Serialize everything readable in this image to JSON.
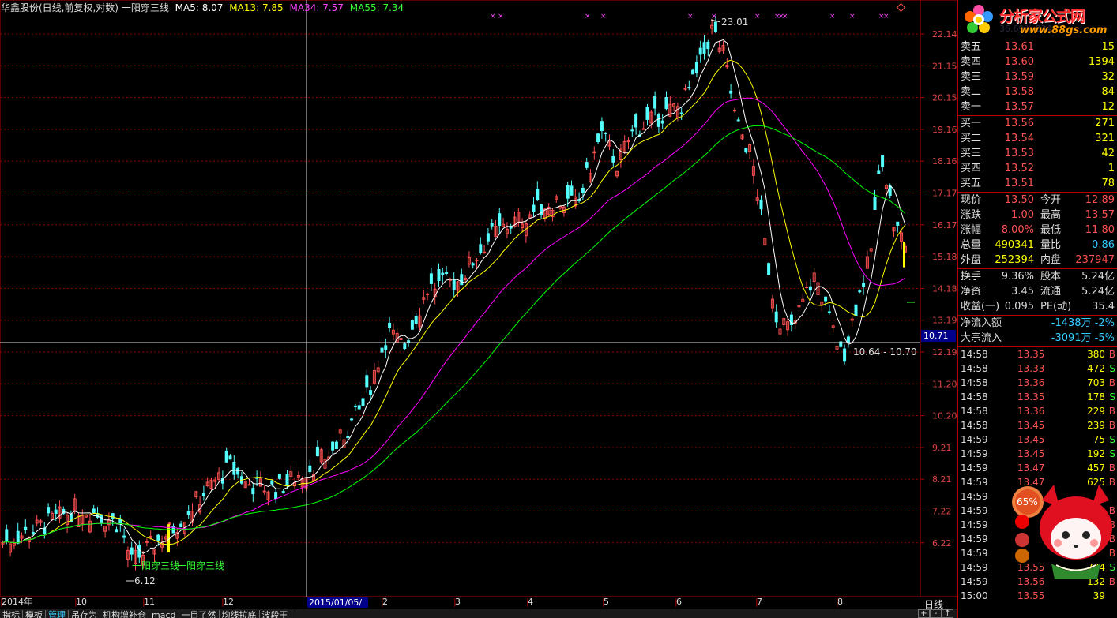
{
  "title": {
    "stock": "华鑫股份(日线,前复权,对数)",
    "indicator": "一阳穿三线",
    "ma5": "MA5: 8.07",
    "ma13": "MA13: 7.85",
    "ma34": "MA34: 7.57",
    "ma55": "MA55: 7.34"
  },
  "colors": {
    "bg": "#000000",
    "up": "#ff5050",
    "down": "#54ffff",
    "grid": "#b00000",
    "ma5": "#ffffff",
    "ma13": "#ffff00",
    "ma34": "#ff00ff",
    "ma55": "#00ff00",
    "special": "#ffff00"
  },
  "price_axis": {
    "labels": [
      "22.14",
      "21.15",
      "20.15",
      "19.16",
      "18.16",
      "17.17",
      "16.17",
      "15.18",
      "14.18",
      "13.19",
      "12.19",
      "11.20",
      "10.20",
      "9.21",
      "8.21",
      "7.22",
      "6.22"
    ]
  },
  "date_axis": {
    "labels": [
      "2014年",
      "10",
      "11",
      "12",
      "2",
      "3",
      "4",
      "5",
      "6",
      "7",
      "8"
    ],
    "cursor_date": "2015/01/05/一",
    "period": "日线"
  },
  "chart_data": {
    "type": "candlestick",
    "x_start": "2014-09",
    "x_end": "2015-08",
    "log_scale": true,
    "ylim": [
      5.9,
      23.4
    ],
    "annotations": {
      "high": "23.01",
      "low": "6.12",
      "range": "10.64 - 10.70",
      "cursor_price": "10.71",
      "signal_label": "一阳穿三线",
      "signal_label2": "一阳穿三线"
    },
    "ma_values": {
      "MA5": 8.07,
      "MA13": 7.85,
      "MA34": 7.57,
      "MA55": 7.34
    }
  },
  "quote": {
    "sell": [
      {
        "label": "卖五",
        "price": "13.61",
        "vol": "15"
      },
      {
        "label": "卖四",
        "price": "13.60",
        "vol": "1394"
      },
      {
        "label": "卖三",
        "price": "13.59",
        "vol": "32"
      },
      {
        "label": "卖二",
        "price": "13.58",
        "vol": "84"
      },
      {
        "label": "卖一",
        "price": "13.57",
        "vol": "12"
      }
    ],
    "buy": [
      {
        "label": "买一",
        "price": "13.56",
        "vol": "271"
      },
      {
        "label": "买二",
        "price": "13.54",
        "vol": "321"
      },
      {
        "label": "买三",
        "price": "13.53",
        "vol": "42"
      },
      {
        "label": "买四",
        "price": "13.52",
        "vol": "1"
      },
      {
        "label": "买五",
        "price": "13.51",
        "vol": "78"
      }
    ],
    "stats": [
      {
        "l1": "现价",
        "v1": "13.50",
        "l2": "今开",
        "v2": "12.89"
      },
      {
        "l1": "涨跌",
        "v1": "1.00",
        "l2": "最高",
        "v2": "13.57"
      },
      {
        "l1": "涨幅",
        "v1": "8.00%",
        "l2": "最低",
        "v2": "11.80"
      },
      {
        "l1": "总量",
        "v1": "490341",
        "l2": "量比",
        "v2": "0.86"
      },
      {
        "l1": "外盘",
        "v1": "252394",
        "l2": "内盘",
        "v2": "237947"
      }
    ],
    "stats2": [
      {
        "l1": "换手",
        "v1": "9.36%",
        "l2": "股本",
        "v2": "5.24亿"
      },
      {
        "l1": "净资",
        "v1": "3.45",
        "l2": "流通",
        "v2": "5.24亿"
      },
      {
        "l1": "收益(一)",
        "v1": "0.095",
        "l2": "PE(动)",
        "v2": "35.4"
      }
    ],
    "flows": [
      {
        "label": "净流入额",
        "value": "-1438万",
        "pct": "-2%"
      },
      {
        "label": "大宗流入",
        "value": "-3091万",
        "pct": "-5%"
      }
    ]
  },
  "ticks": [
    {
      "time": "14:58",
      "price": "13.35",
      "vol": "380",
      "side": "B"
    },
    {
      "time": "14:58",
      "price": "13.33",
      "vol": "472",
      "side": "S"
    },
    {
      "time": "14:58",
      "price": "13.36",
      "vol": "703",
      "side": "B"
    },
    {
      "time": "14:58",
      "price": "13.35",
      "vol": "178",
      "side": "S"
    },
    {
      "time": "14:58",
      "price": "13.36",
      "vol": "229",
      "side": "B"
    },
    {
      "time": "14:58",
      "price": "13.45",
      "vol": "239",
      "side": "B"
    },
    {
      "time": "14:59",
      "price": "13.45",
      "vol": "75",
      "side": "S"
    },
    {
      "time": "14:59",
      "price": "13.45",
      "vol": "192",
      "side": "S"
    },
    {
      "time": "14:59",
      "price": "13.47",
      "vol": "457",
      "side": "B"
    },
    {
      "time": "14:59",
      "price": "13.47",
      "vol": "625",
      "side": "B"
    },
    {
      "time": "14:59",
      "price": "",
      "vol": "",
      "side": ""
    },
    {
      "time": "14:59",
      "price": "",
      "vol": "",
      "side": "B"
    },
    {
      "time": "14:59",
      "price": "",
      "vol": "",
      "side": "B"
    },
    {
      "time": "14:59",
      "price": "",
      "vol": "",
      "side": "B"
    },
    {
      "time": "14:59",
      "price": "",
      "vol": "",
      "side": "B"
    },
    {
      "time": "14:59",
      "price": "13.55",
      "vol": "774",
      "side": "S"
    },
    {
      "time": "14:59",
      "price": "13.56",
      "vol": "132",
      "side": "B"
    },
    {
      "time": "15:00",
      "price": "13.55",
      "vol": "39",
      "side": ""
    }
  ],
  "tabs": [
    "指标",
    "模板",
    "管理",
    "吊存为",
    "机构增补仓",
    "macd",
    "一目了然",
    "均线拉底",
    "波段王"
  ],
  "logo": {
    "brand": "分析家公式网",
    "url": "www.88gs.com",
    "ghost": "36.69% 834"
  },
  "mascot": {
    "badge": "65%"
  },
  "zoom": {
    "plus": "+",
    "minus": "-",
    "up": "↑"
  }
}
